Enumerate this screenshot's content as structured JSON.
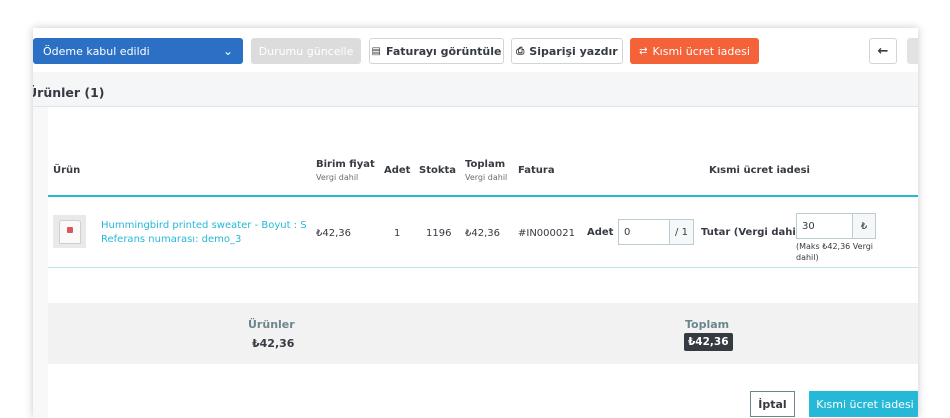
{
  "toolbar": {
    "status_select": "Ödeme kabul edildi",
    "update_status": "Durumu güncelle",
    "view_invoice": "Faturayı görüntüle",
    "print_order": "Siparişi yazdır",
    "partial_refund": "Kısmi ücret iadesi",
    "back_icon": "←"
  },
  "products": {
    "title": "Ürünler (1)",
    "columns": {
      "product": "Ürün",
      "unit_price": "Birim fiyat",
      "unit_price_sub": "Vergi dahil",
      "qty": "Adet",
      "stock": "Stokta",
      "total": "Toplam",
      "total_sub": "Vergi dahil",
      "invoice": "Fatura",
      "partial_refund": "Kısmi ücret iadesi"
    },
    "row": {
      "name_line1": "Hummingbird printed sweater - Boyut : S",
      "name_line2": "Referans numarası: demo_3",
      "unit_price": "₺42,36",
      "qty": "1",
      "stock": "1196",
      "total": "₺42,36",
      "invoice": "#IN000021",
      "refund_qty_label": "Adet",
      "refund_qty_value": "0",
      "refund_qty_max": "/ 1",
      "refund_amount_label": "Tutar (Vergi dahil)",
      "refund_amount_value": "30",
      "currency_symbol": "₺",
      "refund_amount_hint": "(Maks ₺42,36 Vergi dahil)"
    },
    "totals": {
      "products_label": "Ürünler",
      "products_value": "₺42,36",
      "total_label": "Toplam",
      "total_value": "₺42,36"
    },
    "actions": {
      "cancel": "İptal",
      "submit": "Kısmi ücret iadesi"
    }
  },
  "colors": {
    "primary": "#25b9d7",
    "status_blue": "#2b70c5",
    "refund_orange": "#f4623a",
    "dark": "#363a41"
  }
}
